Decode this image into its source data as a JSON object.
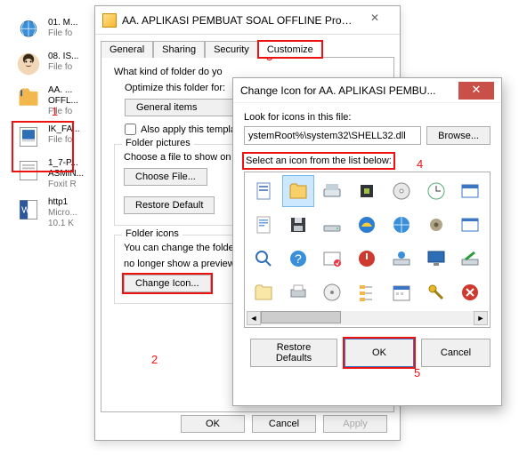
{
  "filelist": [
    {
      "name": "01. M...",
      "sub": "File fo"
    },
    {
      "name": "08. IS...",
      "sub": "File fo"
    },
    {
      "name": "AA. ...",
      "sub": "OFFL...",
      "sub2": "File fo"
    },
    {
      "name": "IK_FA...",
      "sub": "File fo"
    },
    {
      "name": "1_7-P...",
      "sub": "ASMIN...",
      "sub2": "Foxit R"
    },
    {
      "name": "http1",
      "sub": "Micro...",
      "sub2": "10.1 K"
    }
  ],
  "prop": {
    "title": "AA. APLIKASI PEMBUAT SOAL OFFLINE Prope...",
    "tabs": [
      "General",
      "Sharing",
      "Security",
      "Customize"
    ],
    "kind": "What kind of folder do yo",
    "optimize": "Optimize this folder for:",
    "general_items": "General items",
    "also_apply": "Also apply this template",
    "folder_pictures": "Folder pictures",
    "choose_file_caption": "Choose a file to show on t",
    "choose_file": "Choose File...",
    "restore_default": "Restore Default",
    "folder_icons": "Folder icons",
    "change_text": "You can change the folde",
    "change_text2": "no longer show a preview",
    "change_icon": "Change Icon...",
    "ok": "OK",
    "cancel": "Cancel",
    "apply": "Apply"
  },
  "icon": {
    "title": "Change Icon for AA. APLIKASI PEMBU...",
    "look": "Look for icons in this file:",
    "path": "ystemRoot%\\system32\\SHELL32.dll",
    "browse": "Browse...",
    "select": "Select an icon from the list below:",
    "restore": "Restore Defaults",
    "ok": "OK",
    "cancel": "Cancel"
  },
  "annotations": {
    "a1": "1",
    "a2": "2",
    "a3": "3",
    "a4": "4",
    "a5": "5"
  }
}
